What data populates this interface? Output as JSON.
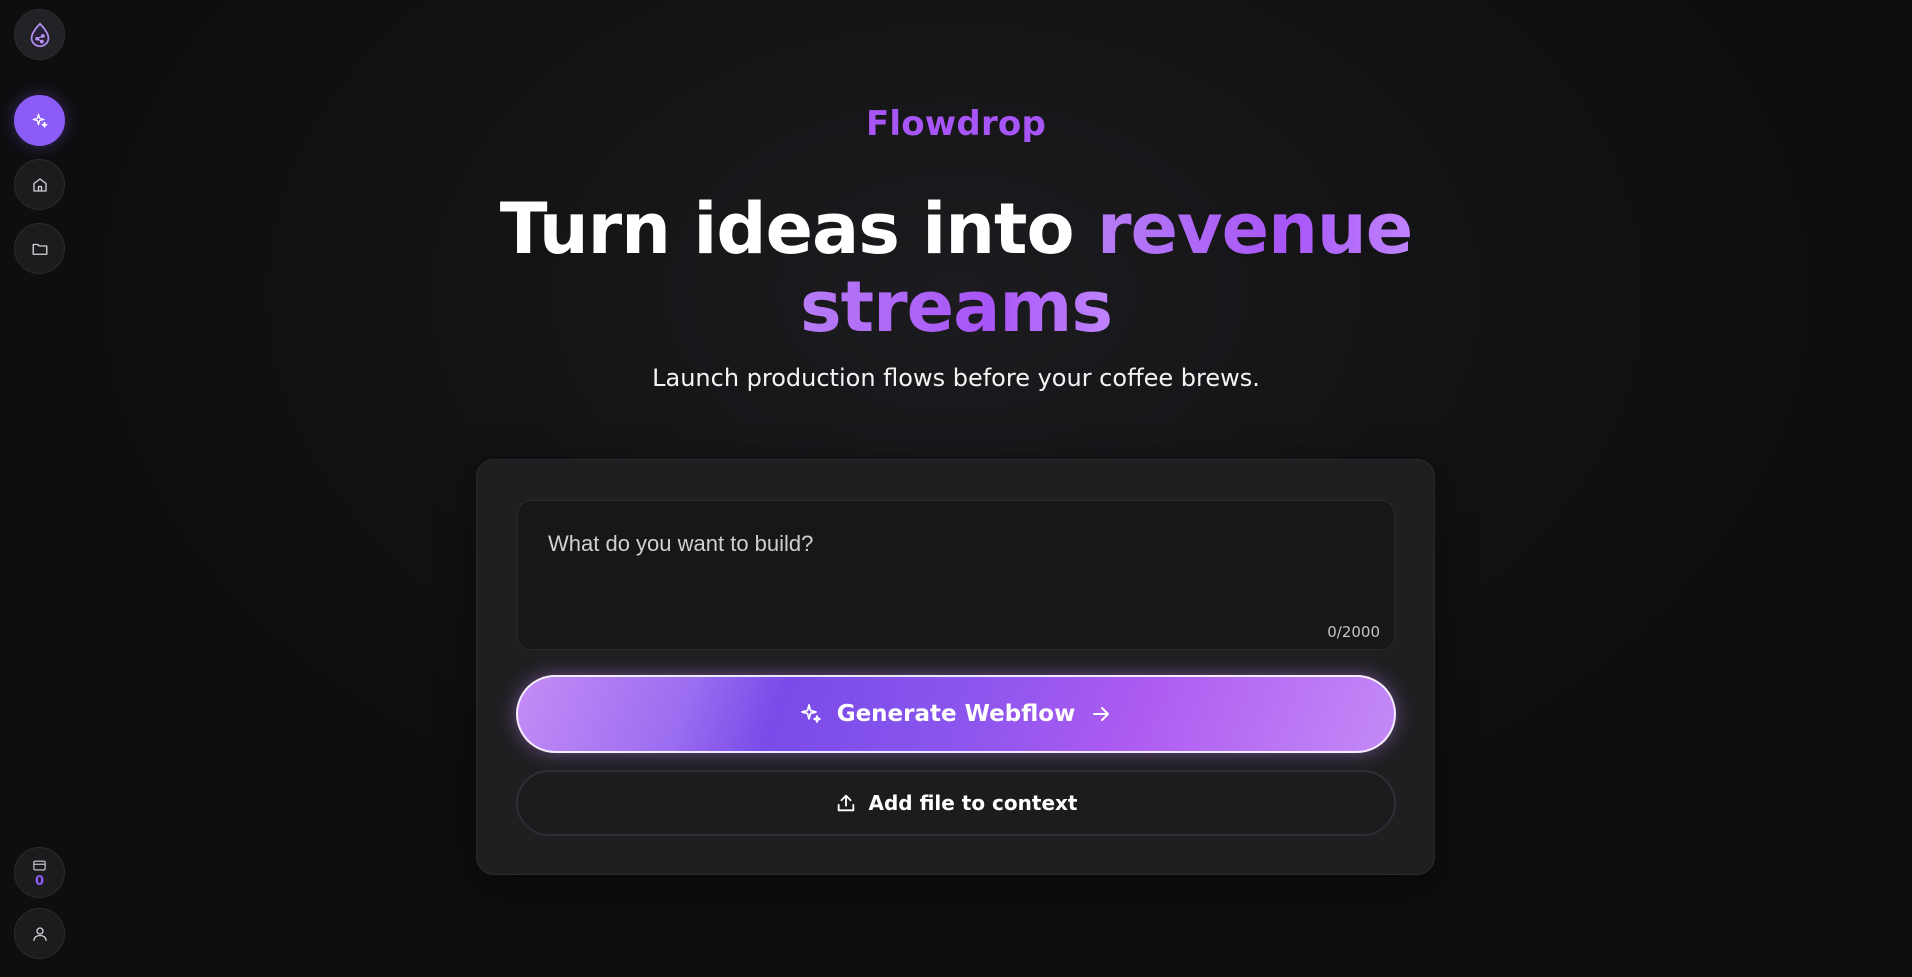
{
  "sidebar": {
    "items": [
      {
        "name": "logo",
        "icon": "flowdrop-logo-icon"
      },
      {
        "name": "generate",
        "icon": "sparkles-icon",
        "active": true
      },
      {
        "name": "home",
        "icon": "home-icon"
      },
      {
        "name": "projects",
        "icon": "folder-icon"
      }
    ],
    "credits": {
      "icon": "credit-card-icon",
      "count": "0"
    },
    "user": {
      "icon": "user-icon"
    }
  },
  "brand": {
    "name": "Flowdrop"
  },
  "hero": {
    "headline_white": "Turn ideas into ",
    "headline_accent_1": "revenue",
    "headline_accent_2": "streams",
    "subtitle": "Launch production flows before your coffee brews."
  },
  "prompt": {
    "placeholder": "What do you want to build?",
    "value": "",
    "char_count": "0/2000"
  },
  "actions": {
    "generate_label": "Generate Webflow",
    "add_file_label": "Add file to context"
  },
  "colors": {
    "accent": "#8b5cf6",
    "accent_text": "#a855f7",
    "background": "#0f0f10",
    "card": "#1f1f21"
  }
}
